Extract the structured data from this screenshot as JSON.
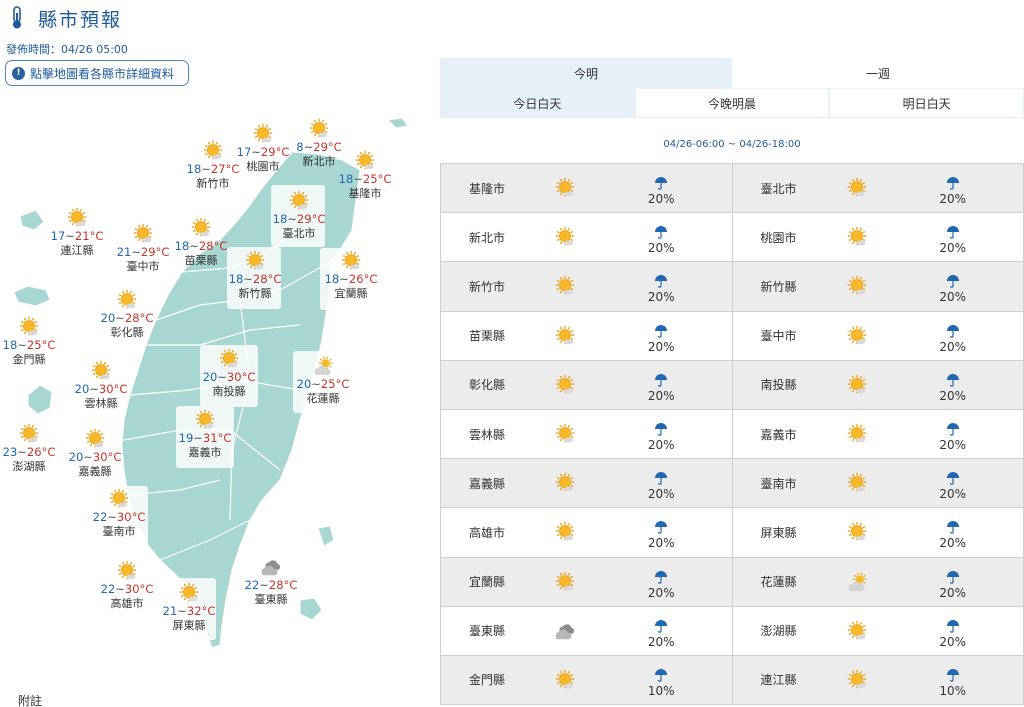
{
  "header": {
    "title": "縣市預報",
    "publish_time": "發佈時間：04/26 05:00",
    "hint": "點擊地圖看各縣市詳細資料",
    "hint_icon": "info-icon"
  },
  "map": {
    "markers": [
      {
        "id": "taoyuan",
        "city": "桃園市",
        "lo": "17",
        "hi": "29",
        "icon": "sunny"
      },
      {
        "id": "new-taipei",
        "city": "新北市",
        "lo": "8",
        "hi": "29",
        "icon": "sunny"
      },
      {
        "id": "hsinchu-city",
        "city": "新竹市",
        "lo": "18",
        "hi": "27",
        "icon": "sunny"
      },
      {
        "id": "keelung",
        "city": "基隆市",
        "lo": "18",
        "hi": "25",
        "icon": "sunny"
      },
      {
        "id": "taipei",
        "city": "臺北市",
        "lo": "18",
        "hi": "29",
        "icon": "sunny"
      },
      {
        "id": "lienchiang",
        "city": "連江縣",
        "lo": "17",
        "hi": "21",
        "icon": "sunny"
      },
      {
        "id": "taichung",
        "city": "臺中市",
        "lo": "21",
        "hi": "29",
        "icon": "sunny"
      },
      {
        "id": "miaoli",
        "city": "苗栗縣",
        "lo": "18",
        "hi": "28",
        "icon": "sunny"
      },
      {
        "id": "hsinchu-county",
        "city": "新竹縣",
        "lo": "18",
        "hi": "28",
        "icon": "sunny"
      },
      {
        "id": "yilan",
        "city": "宜蘭縣",
        "lo": "18",
        "hi": "26",
        "icon": "sunny"
      },
      {
        "id": "changhua",
        "city": "彰化縣",
        "lo": "20",
        "hi": "28",
        "icon": "sunny"
      },
      {
        "id": "kinmen",
        "city": "金門縣",
        "lo": "18",
        "hi": "25",
        "icon": "sunny"
      },
      {
        "id": "nantou",
        "city": "南投縣",
        "lo": "20",
        "hi": "30",
        "icon": "sunny"
      },
      {
        "id": "hualien",
        "city": "花蓮縣",
        "lo": "20",
        "hi": "25",
        "icon": "cloud-sun"
      },
      {
        "id": "yunlin",
        "city": "雲林縣",
        "lo": "20",
        "hi": "30",
        "icon": "sunny"
      },
      {
        "id": "penghu",
        "city": "澎湖縣",
        "lo": "23",
        "hi": "26",
        "icon": "sunny"
      },
      {
        "id": "chiayi-city",
        "city": "嘉義市",
        "lo": "19",
        "hi": "31",
        "icon": "sunny"
      },
      {
        "id": "chiayi-county",
        "city": "嘉義縣",
        "lo": "20",
        "hi": "30",
        "icon": "sunny"
      },
      {
        "id": "tainan",
        "city": "臺南市",
        "lo": "22",
        "hi": "30",
        "icon": "sunny"
      },
      {
        "id": "kaohsiung",
        "city": "高雄市",
        "lo": "22",
        "hi": "30",
        "icon": "sunny"
      },
      {
        "id": "pingtung",
        "city": "屏東縣",
        "lo": "21",
        "hi": "32",
        "icon": "sunny"
      },
      {
        "id": "taitung",
        "city": "臺東縣",
        "lo": "22",
        "hi": "28",
        "icon": "cloudy"
      }
    ],
    "footnote": "附註"
  },
  "tabs": {
    "top": [
      "今明",
      "一週"
    ],
    "sub": [
      "今日白天",
      "今晚明晨",
      "明日白天"
    ]
  },
  "range": "04/26-06:00 ~ 04/26-18:00",
  "table": [
    [
      {
        "city": "基隆市",
        "icon": "sunny",
        "pop": "20%"
      },
      {
        "city": "臺北市",
        "icon": "sunny",
        "pop": "20%"
      }
    ],
    [
      {
        "city": "新北市",
        "icon": "sunny",
        "pop": "20%"
      },
      {
        "city": "桃園市",
        "icon": "sunny",
        "pop": "20%"
      }
    ],
    [
      {
        "city": "新竹市",
        "icon": "sunny",
        "pop": "20%"
      },
      {
        "city": "新竹縣",
        "icon": "sunny",
        "pop": "20%"
      }
    ],
    [
      {
        "city": "苗栗縣",
        "icon": "sunny",
        "pop": "20%"
      },
      {
        "city": "臺中市",
        "icon": "sunny",
        "pop": "20%"
      }
    ],
    [
      {
        "city": "彰化縣",
        "icon": "sunny",
        "pop": "20%"
      },
      {
        "city": "南投縣",
        "icon": "sunny",
        "pop": "20%"
      }
    ],
    [
      {
        "city": "雲林縣",
        "icon": "sunny",
        "pop": "20%"
      },
      {
        "city": "嘉義市",
        "icon": "sunny",
        "pop": "20%"
      }
    ],
    [
      {
        "city": "嘉義縣",
        "icon": "sunny",
        "pop": "20%"
      },
      {
        "city": "臺南市",
        "icon": "sunny",
        "pop": "20%"
      }
    ],
    [
      {
        "city": "高雄市",
        "icon": "sunny",
        "pop": "20%"
      },
      {
        "city": "屏東縣",
        "icon": "sunny",
        "pop": "20%"
      }
    ],
    [
      {
        "city": "宜蘭縣",
        "icon": "sunny",
        "pop": "20%"
      },
      {
        "city": "花蓮縣",
        "icon": "cloud-sun",
        "pop": "20%"
      }
    ],
    [
      {
        "city": "臺東縣",
        "icon": "cloudy",
        "pop": "20%"
      },
      {
        "city": "澎湖縣",
        "icon": "sunny",
        "pop": "20%"
      }
    ],
    [
      {
        "city": "金門縣",
        "icon": "sunny",
        "pop": "10%"
      },
      {
        "city": "連江縣",
        "icon": "sunny",
        "pop": "10%"
      }
    ]
  ],
  "colors": {
    "accent": "#1f5a9c",
    "map_land": "#a8d6d2",
    "low_temp": "#2168b3",
    "high_temp": "#c6342a",
    "tab_active": "#e6f0f8"
  }
}
